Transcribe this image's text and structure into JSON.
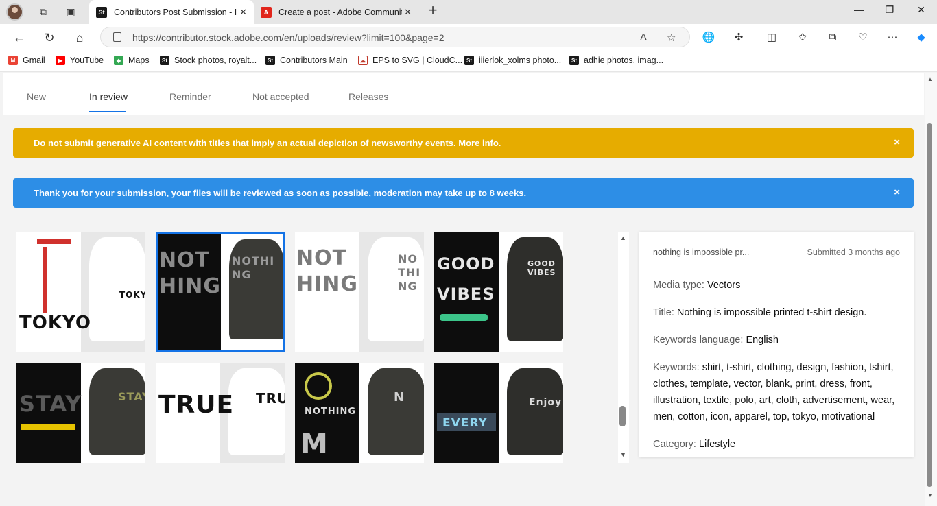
{
  "browser": {
    "tabs": [
      {
        "title": "Contributors Post Submission - In",
        "favicon": "St",
        "active": true
      },
      {
        "title": "Create a post - Adobe Communit",
        "favicon": "A",
        "active": false
      }
    ],
    "new_tab": "+",
    "url": "https://contributor.stock.adobe.com/en/uploads/review?limit=100&page=2",
    "bookmarks": [
      {
        "label": "Gmail",
        "icon": "M"
      },
      {
        "label": "YouTube",
        "icon": "▶"
      },
      {
        "label": "Maps",
        "icon": "◆"
      },
      {
        "label": "Stock photos, royalt...",
        "icon": "St"
      },
      {
        "label": "Contributors Main",
        "icon": "St"
      },
      {
        "label": "EPS to SVG | CloudC...",
        "icon": "☁"
      },
      {
        "label": "iiierlok_xolms photo...",
        "icon": "St"
      },
      {
        "label": "adhie photos, imag...",
        "icon": "St"
      }
    ]
  },
  "nav": {
    "tabs": [
      "New",
      "In review",
      "Reminder",
      "Not accepted",
      "Releases"
    ],
    "active": "In review"
  },
  "banners": {
    "warning": {
      "text": "Do not submit generative AI content with titles that imply an actual depiction of newsworthy events.",
      "link": "More info",
      "suffix": ".",
      "close": "×"
    },
    "info": {
      "text": "Thank you for your submission, your files will be reviewed as soon as possible, moderation may take up to 8 weeks.",
      "close": "×"
    }
  },
  "thumbnails": [
    {
      "caption": "TOKYO",
      "theme": "light"
    },
    {
      "caption": "NOTHING",
      "theme": "dark",
      "selected": true
    },
    {
      "caption": "NOTHING",
      "theme": "light"
    },
    {
      "caption": "GOOD VIBES",
      "theme": "dark"
    },
    {
      "caption": "STAY",
      "theme": "dark"
    },
    {
      "caption": "TRUE",
      "theme": "light"
    },
    {
      "caption": "NOTHING",
      "theme": "dark"
    },
    {
      "caption": "EVERY",
      "theme": "dark"
    }
  ],
  "details": {
    "name": "nothing is impossible pr...",
    "submitted": "Submitted 3 months ago",
    "media_type_label": "Media type:",
    "media_type": "Vectors",
    "title_label": "Title:",
    "title": "Nothing is impossible printed t-shirt design.",
    "lang_label": "Keywords language:",
    "lang": "English",
    "keywords_label": "Keywords:",
    "keywords": "shirt, t-shirt, clothing, design, fashion, tshirt, clothes, template, vector, blank, print, dress, front, illustration, textile, polo, art, cloth, advertisement, wear, men, cotton, icon, apparel, top, tokyo, motivational",
    "category_label": "Category:",
    "category": "Lifestyle"
  }
}
